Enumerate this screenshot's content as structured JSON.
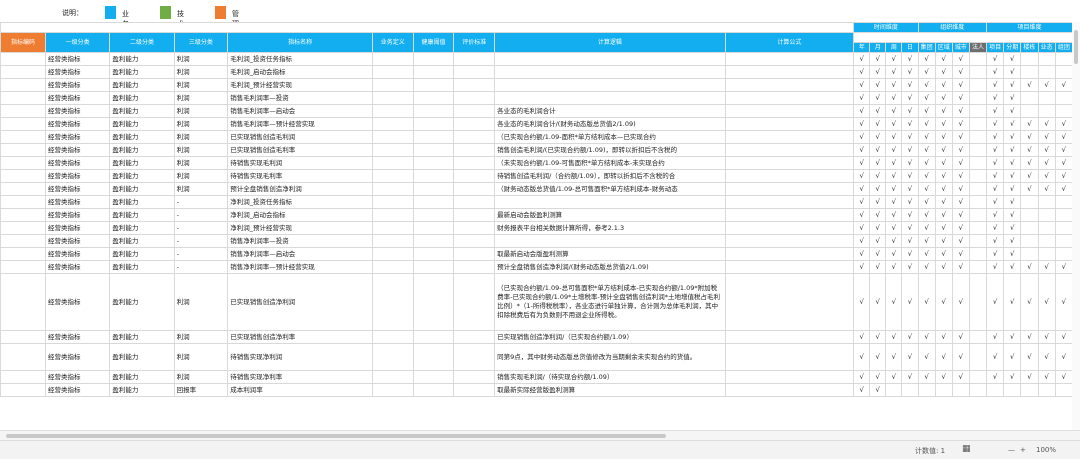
{
  "legend": {
    "label": "说明：",
    "items": [
      {
        "text": "业务属性",
        "color": "#12aeef"
      },
      {
        "text": "技术属性",
        "color": "#70ad47"
      },
      {
        "text": "管理属性",
        "color": "#ef7d31"
      }
    ]
  },
  "header": {
    "top_groups": [
      {
        "name": "时间维度"
      },
      {
        "name": "组织维度"
      },
      {
        "name": "项目维度"
      }
    ],
    "columns": [
      "指标编码",
      "一级分类",
      "二级分类",
      "三级分类",
      "指标名称",
      "业务定义",
      "健康阈值",
      "评价标准",
      "计算逻辑",
      "计算公式"
    ],
    "time_dims": [
      "年",
      "月",
      "周",
      "日"
    ],
    "org_dims": [
      "集团",
      "区域",
      "城市",
      "法人"
    ],
    "proj_dims": [
      "项目",
      "分期",
      "楼栋",
      "业态",
      "组团"
    ]
  },
  "rows": [
    {
      "c1": "经营类指标",
      "c2": "盈利能力",
      "c3": "利润",
      "name": "毛利润_投资任务指标",
      "logic": "",
      "checks": [
        "√",
        "√",
        "√",
        "√",
        "√",
        "√",
        "√",
        "",
        "√",
        "√",
        "",
        "",
        ""
      ]
    },
    {
      "c1": "经营类指标",
      "c2": "盈利能力",
      "c3": "利润",
      "name": "毛利润_启动会指标",
      "logic": "",
      "checks": [
        "√",
        "√",
        "√",
        "√",
        "√",
        "√",
        "√",
        "",
        "√",
        "√",
        "",
        "",
        ""
      ]
    },
    {
      "c1": "经营类指标",
      "c2": "盈利能力",
      "c3": "利润",
      "name": "毛利润_预计经营实现",
      "logic": "",
      "checks": [
        "√",
        "√",
        "√",
        "√",
        "√",
        "√",
        "√",
        "",
        "√",
        "√",
        "√",
        "√",
        "√"
      ]
    },
    {
      "c1": "经营类指标",
      "c2": "盈利能力",
      "c3": "利润",
      "name": "销售毛利润率—投资",
      "logic": "",
      "checks": [
        "√",
        "√",
        "√",
        "√",
        "√",
        "√",
        "√",
        "",
        "√",
        "√",
        "",
        "",
        ""
      ]
    },
    {
      "c1": "经营类指标",
      "c2": "盈利能力",
      "c3": "利润",
      "name": "销售毛利润率—启动会",
      "logic": "各业态的毛利润合计",
      "checks": [
        "√",
        "√",
        "√",
        "√",
        "√",
        "√",
        "√",
        "",
        "√",
        "√",
        "",
        "",
        ""
      ]
    },
    {
      "c1": "经营类指标",
      "c2": "盈利能力",
      "c3": "利润",
      "name": "销售毛利润率—预计经营实现",
      "logic": "各业态的毛利润合计/(财务动态版总货值2/1.09)",
      "checks": [
        "√",
        "√",
        "√",
        "√",
        "√",
        "√",
        "√",
        "",
        "√",
        "√",
        "√",
        "√",
        "√"
      ]
    },
    {
      "c1": "经营类指标",
      "c2": "盈利能力",
      "c3": "利润",
      "name": "已实现销售创造毛利润",
      "logic": "（已实现合约额/1.09-面积*单方结利成本—已实现合约",
      "checks": [
        "√",
        "√",
        "√",
        "√",
        "√",
        "√",
        "√",
        "",
        "√",
        "√",
        "√",
        "√",
        "√"
      ]
    },
    {
      "c1": "经营类指标",
      "c2": "盈利能力",
      "c3": "利润",
      "name": "已实现销售创造毛利率",
      "logic": "销售创造毛利润/(已实现合约额/1.09)，即转以折扣后不含税的",
      "checks": [
        "√",
        "√",
        "√",
        "√",
        "√",
        "√",
        "√",
        "",
        "√",
        "√",
        "√",
        "√",
        "√"
      ]
    },
    {
      "c1": "经营类指标",
      "c2": "盈利能力",
      "c3": "利润",
      "name": "待销售实现毛利润",
      "logic": "（未实现合约额/1.09-可售面积*单方结利成本-未实现合约",
      "checks": [
        "√",
        "√",
        "√",
        "√",
        "√",
        "√",
        "√",
        "",
        "√",
        "√",
        "√",
        "√",
        "√"
      ]
    },
    {
      "c1": "经营类指标",
      "c2": "盈利能力",
      "c3": "利润",
      "name": "待销售实现毛利率",
      "logic": "待销售创造毛利润/（合约额/1.09），即转以折扣后不含税的合",
      "checks": [
        "√",
        "√",
        "√",
        "√",
        "√",
        "√",
        "√",
        "",
        "√",
        "√",
        "√",
        "√",
        "√"
      ]
    },
    {
      "c1": "经营类指标",
      "c2": "盈利能力",
      "c3": "利润",
      "name": "预计全盘销售创造净利润",
      "logic": "（财务动态版总货值/1.09-总可售面积*单方结利成本-财务动态",
      "checks": [
        "√",
        "√",
        "√",
        "√",
        "√",
        "√",
        "√",
        "",
        "√",
        "√",
        "√",
        "√",
        "√"
      ]
    },
    {
      "c1": "经营类指标",
      "c2": "盈利能力",
      "c3": "-",
      "name": "净利润_投资任务指标",
      "logic": "",
      "checks": [
        "√",
        "√",
        "√",
        "√",
        "√",
        "√",
        "√",
        "",
        "√",
        "√",
        "",
        "",
        ""
      ]
    },
    {
      "c1": "经营类指标",
      "c2": "盈利能力",
      "c3": "-",
      "name": "净利润_启动会指标",
      "logic": "最新启动会版盈利测算",
      "checks": [
        "√",
        "√",
        "√",
        "√",
        "√",
        "√",
        "√",
        "",
        "√",
        "√",
        "",
        "",
        ""
      ]
    },
    {
      "c1": "经营类指标",
      "c2": "盈利能力",
      "c3": "-",
      "name": "净利润_预计经营实现",
      "logic": "财务报表平台相关数据计算所得，参考2.1.3",
      "checks": [
        "√",
        "√",
        "√",
        "√",
        "√",
        "√",
        "√",
        "",
        "√",
        "√",
        "",
        "",
        ""
      ]
    },
    {
      "c1": "经营类指标",
      "c2": "盈利能力",
      "c3": "-",
      "name": "销售净利润率—投资",
      "logic": "",
      "checks": [
        "√",
        "√",
        "√",
        "√",
        "√",
        "√",
        "√",
        "",
        "√",
        "√",
        "",
        "",
        ""
      ]
    },
    {
      "c1": "经营类指标",
      "c2": "盈利能力",
      "c3": "-",
      "name": "销售净利润率—启动会",
      "logic": "取最新启动会版盈利测算",
      "checks": [
        "√",
        "√",
        "√",
        "√",
        "√",
        "√",
        "√",
        "",
        "√",
        "√",
        "",
        "",
        ""
      ]
    },
    {
      "c1": "经营类指标",
      "c2": "盈利能力",
      "c3": "-",
      "name": "销售净利润率—预计经营实现",
      "logic": "预计全盘销售创造净利润/(财务动态版总货值2/1.09)",
      "checks": [
        "√",
        "√",
        "√",
        "√",
        "√",
        "√",
        "√",
        "",
        "√",
        "√",
        "√",
        "√",
        "√"
      ]
    },
    {
      "c1": "经营类指标",
      "c2": "盈利能力",
      "c3": "利润",
      "name": "已实现销售创造净利润",
      "logic": "（已实现合约额/1.09-总可售面积*单方结利成本-已实现合约额/1.09*附加税费率-已实现合约额/1.09*土增税率-预计全盘销售创造利润*土地增值税占毛利比例）*（1-所得税税率），各业态进行单独计算，合计则为总体毛利润，其中扣除税费后有为负数则不用退企业所得税。",
      "checks": [
        "√",
        "√",
        "√",
        "√",
        "√",
        "√",
        "√",
        "",
        "√",
        "√",
        "√",
        "√",
        "√"
      ],
      "tall": true
    },
    {
      "c1": "经营类指标",
      "c2": "盈利能力",
      "c3": "利润",
      "name": "已实现销售创造净利率",
      "logic": "已实现销售创造净利润/（已实现合约额/1.09）",
      "checks": [
        "√",
        "√",
        "√",
        "√",
        "√",
        "√",
        "√",
        "",
        "√",
        "√",
        "√",
        "√",
        "√"
      ]
    },
    {
      "c1": "经营类指标",
      "c2": "盈利能力",
      "c3": "利润",
      "name": "待销售实现净利润",
      "logic": "同第9点，其中财务动态版总货值修改为当期剩余未实现合约的货值。",
      "checks": [
        "√",
        "√",
        "√",
        "√",
        "√",
        "√",
        "√",
        "",
        "√",
        "√",
        "√",
        "√",
        "√"
      ],
      "mid": true
    },
    {
      "c1": "经营类指标",
      "c2": "盈利能力",
      "c3": "利润",
      "name": "待销售实现净利率",
      "logic": "销售实现毛利润/（待实现合约额/1.09）",
      "checks": [
        "√",
        "√",
        "√",
        "√",
        "√",
        "√",
        "√",
        "",
        "√",
        "√",
        "√",
        "√",
        "√"
      ]
    },
    {
      "c1": "经营类指标",
      "c2": "盈利能力",
      "c3": "回报率",
      "name": "成本利润率",
      "logic": "取最新实际经营版盈利测算",
      "checks": [
        "√",
        "√",
        "",
        "",
        "",
        "",
        "",
        "",
        "",
        "",
        "",
        "",
        ""
      ]
    }
  ],
  "status_bar": {
    "count_label": "计数值: 1",
    "zoom": "100%",
    "zoom_minus": "—",
    "zoom_plus": "+"
  }
}
